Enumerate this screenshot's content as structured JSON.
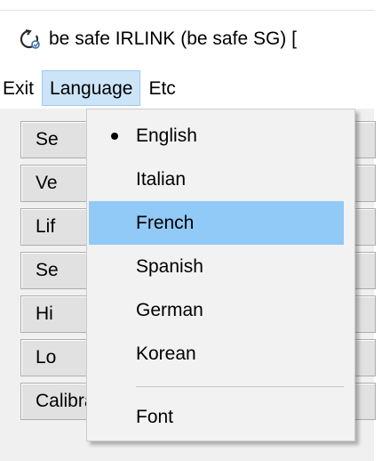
{
  "window": {
    "title": "be safe IRLINK (be safe SG) [",
    "app_icon": "refresh-arrow-icon"
  },
  "menubar": {
    "items": [
      {
        "label": "Exit"
      },
      {
        "label": "Language"
      },
      {
        "label": "Etc"
      }
    ],
    "open_menu": "Language"
  },
  "language_menu": {
    "items": [
      {
        "label": "English",
        "checked": true
      },
      {
        "label": "Italian",
        "checked": false
      },
      {
        "label": "French",
        "checked": false,
        "highlighted": true
      },
      {
        "label": "Spanish",
        "checked": false
      },
      {
        "label": "German",
        "checked": false
      },
      {
        "label": "Korean",
        "checked": false
      }
    ],
    "font_label": "Font"
  },
  "main": {
    "buttons": [
      {
        "label": "Se"
      },
      {
        "label": "Ve"
      },
      {
        "label": "Lif"
      },
      {
        "label": "Se"
      },
      {
        "label": "Hi"
      },
      {
        "label": "Lo"
      },
      {
        "label": "Calibration interval"
      }
    ]
  },
  "colors": {
    "menu_open_bg": "#cce4f7",
    "menu_highlight_bg": "#91c9f7",
    "window_bg": "#f0f0f0"
  }
}
